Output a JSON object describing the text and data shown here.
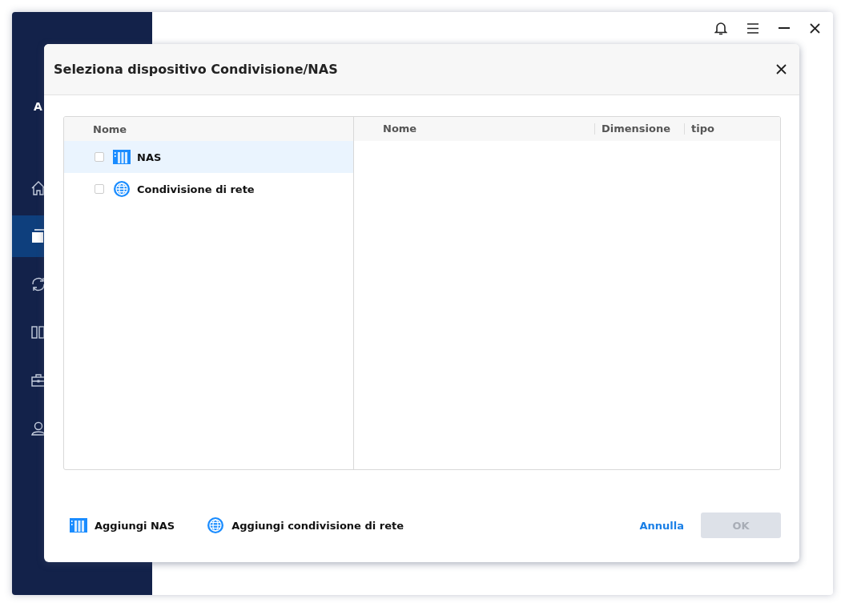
{
  "app": {
    "brand": "A",
    "sidebar": {
      "items": [
        {
          "kind": "home",
          "selected": false
        },
        {
          "kind": "copy",
          "selected": true
        },
        {
          "kind": "sync",
          "selected": false
        },
        {
          "kind": "columns",
          "selected": false
        },
        {
          "kind": "toolbox",
          "selected": false
        },
        {
          "kind": "user",
          "selected": false
        }
      ]
    },
    "window_controls": [
      {
        "kind": "bell"
      },
      {
        "kind": "menu"
      },
      {
        "kind": "minimize"
      },
      {
        "kind": "close"
      }
    ]
  },
  "dialog": {
    "title": "Seleziona dispositivo Condivisione/NAS",
    "tree": {
      "column": "Nome",
      "items": [
        {
          "label": "NAS",
          "kind": "nas",
          "checked": false,
          "selected": true
        },
        {
          "label": "Condivisione di rete",
          "kind": "network",
          "checked": false,
          "selected": false
        }
      ]
    },
    "list": {
      "columns": [
        "Nome",
        "Dimensione",
        "tipo"
      ]
    },
    "actions": [
      {
        "label": "Aggiungi NAS",
        "kind": "nas"
      },
      {
        "label": "Aggiungi condivisione di rete",
        "kind": "network"
      }
    ],
    "buttons": [
      {
        "label": "Annulla",
        "kind": "link",
        "disabled": false
      },
      {
        "label": "OK",
        "kind": "primary",
        "disabled": true
      }
    ]
  }
}
